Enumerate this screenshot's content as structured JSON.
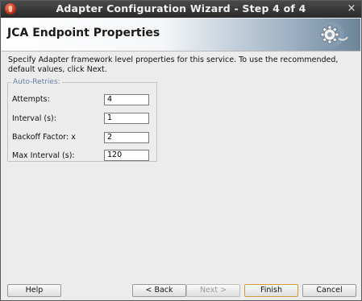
{
  "window": {
    "title": "Adapter Configuration Wizard - Step 4 of 4",
    "close_glyph": "×"
  },
  "banner": {
    "heading": "JCA Endpoint Properties",
    "icon": "gear-icon"
  },
  "description": "Specify Adapter framework level properties for this service.  To use the recommended, default values, click Next.",
  "auto_retries": {
    "legend": "Auto-Retries:",
    "fields": [
      {
        "label": "Attempts:",
        "value": "4"
      },
      {
        "label": "Interval (s):",
        "value": "1"
      },
      {
        "label": "Backoff Factor: x",
        "value": "2"
      },
      {
        "label": "Max Interval (s):",
        "value": "120"
      }
    ]
  },
  "buttons": {
    "help": "Help",
    "back": "< Back",
    "next": "Next >",
    "finish": "Finish",
    "cancel": "Cancel"
  }
}
